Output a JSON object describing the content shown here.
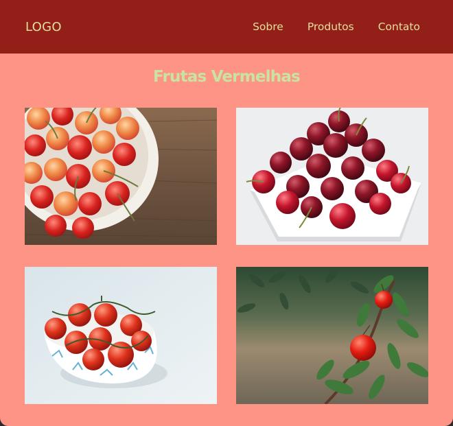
{
  "header": {
    "logo": "LOGO",
    "nav": [
      {
        "label": "Sobre"
      },
      {
        "label": "Produtos"
      },
      {
        "label": "Contato"
      }
    ]
  },
  "main": {
    "title": "Frutas Vermelhas",
    "photos": [
      {
        "subject": "bowl of rainier cherries on wooden table"
      },
      {
        "subject": "dark cherries on white square plate"
      },
      {
        "subject": "cherry tomatoes in blue patterned bowl"
      },
      {
        "subject": "red cherries on tree branch"
      }
    ]
  },
  "colors": {
    "header_bg": "#921f18",
    "page_bg": "#fe9485",
    "nav_text": "#e6df9f",
    "title_text": "#c8e3a2"
  }
}
